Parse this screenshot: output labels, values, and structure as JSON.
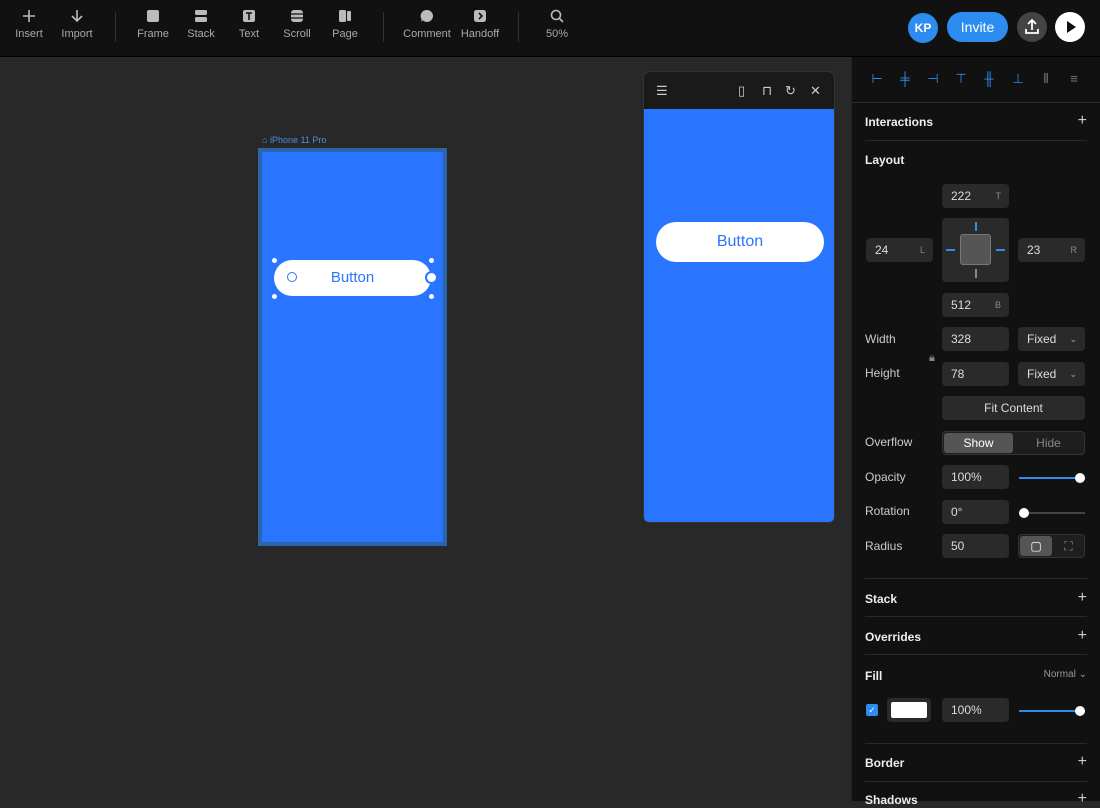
{
  "toolbar": {
    "insert": "Insert",
    "import": "Import",
    "frame": "Frame",
    "stack": "Stack",
    "text": "Text",
    "scroll": "Scroll",
    "page": "Page",
    "comment": "Comment",
    "handoff": "Handoff",
    "zoom": "50%"
  },
  "user": {
    "initials": "KP",
    "invite": "Invite"
  },
  "canvas": {
    "frame_label": "iPhone 11 Pro",
    "button_label": "Button",
    "preview_button_label": "Button"
  },
  "panel": {
    "interactions": "Interactions",
    "layout": "Layout",
    "top": "222",
    "top_suffix": "T",
    "left": "24",
    "left_suffix": "L",
    "right": "23",
    "right_suffix": "R",
    "bottom": "512",
    "bottom_suffix": "B",
    "width_label": "Width",
    "width": "328",
    "width_mode": "Fixed",
    "height_label": "Height",
    "height": "78",
    "height_mode": "Fixed",
    "fit_content": "Fit Content",
    "overflow_label": "Overflow",
    "overflow_show": "Show",
    "overflow_hide": "Hide",
    "opacity_label": "Opacity",
    "opacity": "100%",
    "opacity_level": 1.0,
    "rotation_label": "Rotation",
    "rotation": "0°",
    "rotation_level": 0.0,
    "radius_label": "Radius",
    "radius": "50",
    "stack": "Stack",
    "overrides": "Overrides",
    "fill": "Fill",
    "fill_mode": "Normal",
    "fill_opacity": "100%",
    "fill_color": "#ffffff",
    "fill_level": 1.0,
    "border": "Border",
    "shadows": "Shadows"
  },
  "colors": {
    "accent": "#2d8cf0",
    "frame_blue": "#2a75ff"
  }
}
